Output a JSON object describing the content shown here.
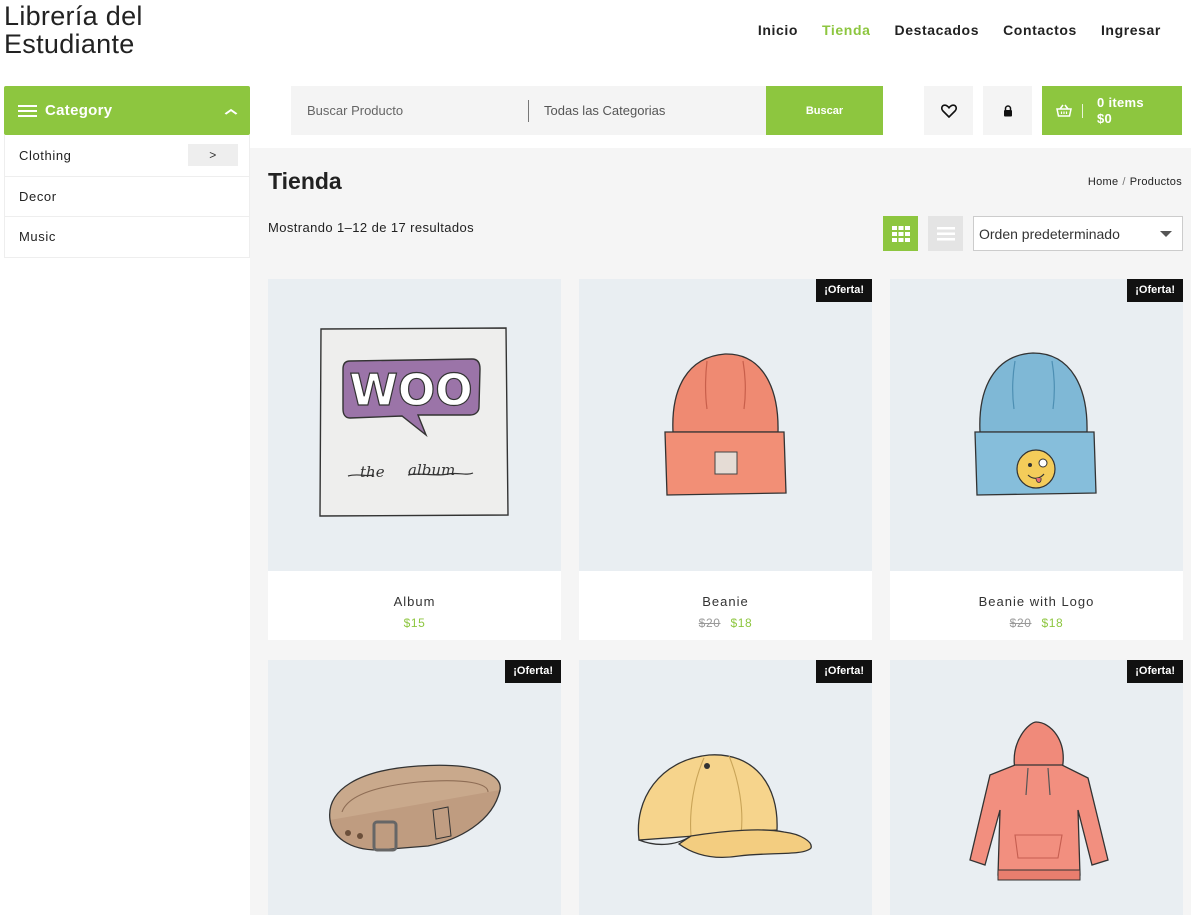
{
  "header": {
    "brand_line1": "Librería del",
    "brand_line2": "Estudiante",
    "nav": [
      {
        "label": "Inicio"
      },
      {
        "label": "Tienda",
        "active": true
      },
      {
        "label": "Destacados"
      },
      {
        "label": "Contactos"
      },
      {
        "label": "Ingresar"
      }
    ],
    "accent_color": "#8dc63f"
  },
  "sidebar": {
    "title": "Category",
    "items": [
      {
        "label": "Clothing",
        "arrow": ">"
      },
      {
        "label": "Decor"
      },
      {
        "label": "Music"
      }
    ]
  },
  "search": {
    "placeholder": "Buscar Producto",
    "category": "Todas las Categorias",
    "button": "Buscar"
  },
  "icons": [
    "heart-icon",
    "lock-icon",
    "basket-icon",
    "grid-icon",
    "list-icon"
  ],
  "cart": {
    "items": "0 items",
    "total": "$0"
  },
  "main": {
    "title": "Tienda",
    "breadcrumb": [
      "Home",
      "Productos"
    ],
    "result_count": "Mostrando 1–12 de 17 resultados",
    "orderby": "Orden predeterminado"
  },
  "products": [
    {
      "name": "Album",
      "price": "$15",
      "old_price": null,
      "badge": null,
      "image": "woo-album"
    },
    {
      "name": "Beanie",
      "price": "$18",
      "old_price": "$20",
      "badge": "¡Oferta!",
      "image": "beanie"
    },
    {
      "name": "Beanie with Logo",
      "price": "$18",
      "old_price": "$20",
      "badge": "¡Oferta!",
      "image": "beanie-logo"
    },
    {
      "name": "",
      "badge": "¡Oferta!",
      "image": "belt"
    },
    {
      "name": "",
      "badge": "¡Oferta!",
      "image": "cap"
    },
    {
      "name": "",
      "badge": "¡Oferta!",
      "image": "hoodie"
    }
  ]
}
